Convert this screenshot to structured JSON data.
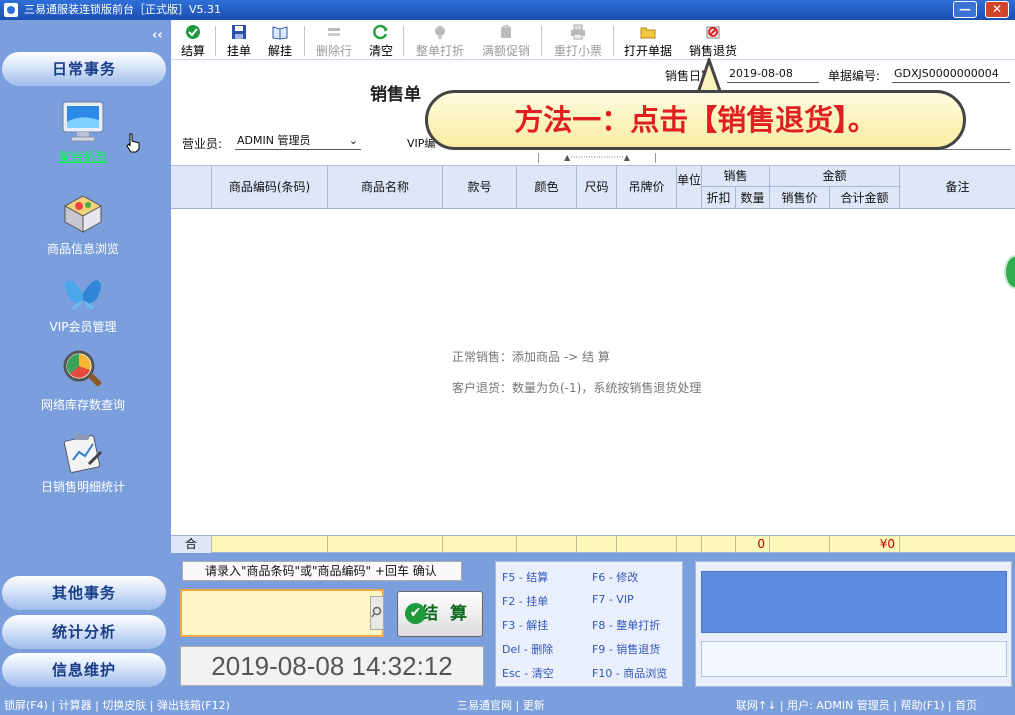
{
  "window": {
    "title": "三易通服装连锁版前台［正式版］V5.31",
    "min_label": "—",
    "close_label": "✕"
  },
  "sidebar": {
    "collapse": "‹‹",
    "section_top": "日常事务",
    "items": [
      {
        "label": "前台销售",
        "icon": "monitor-icon",
        "active": true
      },
      {
        "label": "商品信息浏览",
        "icon": "boxes-icon",
        "active": false
      },
      {
        "label": "VIP会员管理",
        "icon": "butterfly-icon",
        "active": false
      },
      {
        "label": "网络库存数查询",
        "icon": "magnifier-chart-icon",
        "active": false
      },
      {
        "label": "日销售明细统计",
        "icon": "clipboard-stats-icon",
        "active": false
      }
    ],
    "sections_bottom": [
      "其他事务",
      "统计分析",
      "信息维护"
    ]
  },
  "toolbar": {
    "buttons": [
      {
        "label": "结算",
        "icon": "check-icon",
        "enabled": true
      },
      {
        "label": "挂单",
        "icon": "save-icon",
        "enabled": true
      },
      {
        "label": "解挂",
        "icon": "book-icon",
        "enabled": true
      },
      {
        "label": "删除行",
        "icon": "delete-row-icon",
        "enabled": false
      },
      {
        "label": "清空",
        "icon": "refresh-icon",
        "enabled": true
      },
      {
        "label": "整单打折",
        "icon": "discount-icon",
        "enabled": false
      },
      {
        "label": "满额促销",
        "icon": "promo-icon",
        "enabled": false
      },
      {
        "label": "重打小票",
        "icon": "printer-icon",
        "enabled": false
      },
      {
        "label": "打开单据",
        "icon": "folder-icon",
        "enabled": true
      },
      {
        "label": "销售退货",
        "icon": "return-icon",
        "enabled": true
      }
    ]
  },
  "form": {
    "title": "销售单",
    "sale_date_label": "销售日期",
    "sale_date": "2019-08-08",
    "doc_no_label": "单据编号:",
    "doc_no": "GDXJS0000000004",
    "clerk_label": "营业员:",
    "clerk_value": "ADMIN 管理员",
    "vip_label": "VIP编",
    "splitter": "▲·····················▲"
  },
  "callout": {
    "text": "方法一：点击【销售退货】。"
  },
  "grid": {
    "columns": [
      "商品编码(条码)",
      "商品名称",
      "款号",
      "颜色",
      "尺码",
      "吊牌价",
      "单位"
    ],
    "sales_group": "销售",
    "sales_sub": [
      "折扣",
      "数量"
    ],
    "amount_group": "金额",
    "amount_sub": [
      "销售价",
      "合计金额"
    ],
    "remark": "备注",
    "hint1": "正常销售：添加商品 -> 结 算",
    "hint2": "客户退货：数量为负(-1)，系统按销售退货处理",
    "total_label": "合计",
    "total_qty": "0",
    "total_amount": "¥0"
  },
  "bottom": {
    "prompt": "请录入\"商品条码\"或\"商品编码\" +回车 确认",
    "checkout_label": "结 算",
    "checkout_icon": "✔",
    "clock": "2019-08-08 14:32:12",
    "shortcuts": [
      "F5 - 结算",
      "F6 - 修改",
      "F2 - 挂单",
      "F7 - VIP",
      "F3 - 解挂",
      "F8 - 整单打折",
      "Del - 删除",
      "F9 - 销售退货",
      "Esc - 清空",
      "F10 - 商品浏览"
    ]
  },
  "statusbar": {
    "left": "锁屏(F4) | 计算器 | 切换皮肤 | 弹出钱箱(F12)",
    "center": "三易通官网 | 更新",
    "right": "联网↑↓ | 用户: ADMIN 管理员 | 帮助(F1) | 首页"
  }
}
